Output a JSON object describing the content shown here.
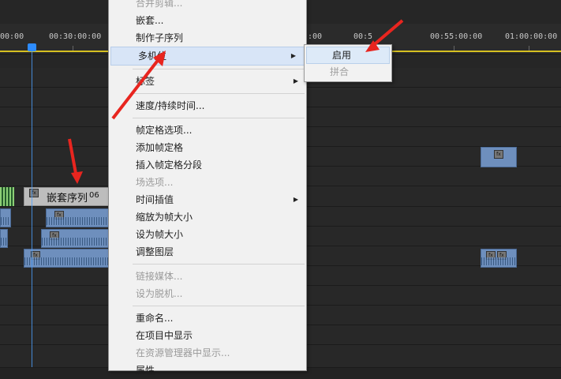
{
  "timeline": {
    "timecodes": [
      "00:00",
      "00:30:00:00",
      ":00",
      "00:5",
      "00:55:00:00",
      "01:00:00:00"
    ],
    "nested_clip_label": "嵌套序列",
    "nested_clip_number": "06"
  },
  "context_menu": {
    "items": [
      {
        "label": "合并剪辑...",
        "disabled": true
      },
      {
        "label": "嵌套..."
      },
      {
        "label": "制作子序列"
      },
      {
        "label": "多机位",
        "submenu": true,
        "highlighted": true
      },
      {
        "label": "标签",
        "submenu": true
      },
      {
        "label": "速度/持续时间..."
      },
      {
        "label": "帧定格选项..."
      },
      {
        "label": "添加帧定格"
      },
      {
        "label": "插入帧定格分段"
      },
      {
        "label": "场选项...",
        "disabled": true
      },
      {
        "label": "时间插值",
        "submenu": true
      },
      {
        "label": "缩放为帧大小"
      },
      {
        "label": "设为帧大小"
      },
      {
        "label": "调整图层"
      },
      {
        "label": "链接媒体...",
        "disabled": true
      },
      {
        "label": "设为脱机...",
        "disabled": true
      },
      {
        "label": "重命名..."
      },
      {
        "label": "在项目中显示"
      },
      {
        "label": "在资源管理器中显示...",
        "disabled": true
      },
      {
        "label": "属性"
      }
    ],
    "submenu_arrow": "▶"
  },
  "submenu": {
    "items": [
      {
        "label": "启用",
        "highlighted": true
      },
      {
        "label": "拼合",
        "disabled": true
      }
    ]
  },
  "colors": {
    "annotation_arrow": "#e8251f",
    "playhead": "#2d8cff",
    "work_area_bar": "#d6c021"
  }
}
